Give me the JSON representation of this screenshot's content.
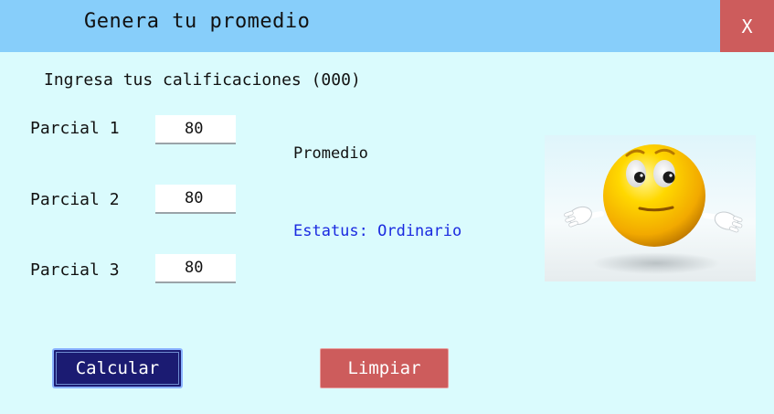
{
  "window": {
    "title": "Genera tu promedio",
    "close_label": "X"
  },
  "form": {
    "instructions": "Ingresa tus calificaciones (000)",
    "fields": [
      {
        "label": "Parcial 1",
        "value": "80"
      },
      {
        "label": "Parcial 2",
        "value": "80"
      },
      {
        "label": "Parcial 3",
        "value": "80"
      }
    ]
  },
  "results": {
    "average_label": "Promedio",
    "status_text": "Estatus: Ordinario"
  },
  "actions": {
    "calculate_label": "Calcular",
    "clear_label": "Limpiar"
  },
  "image": {
    "icon": "emoji-shrug-icon"
  },
  "colors": {
    "background": "#dafbfd",
    "titlebar": "#87cefa",
    "close_button": "#cd5c5c",
    "calculate_button": "#1b1b72",
    "clear_button": "#cd5c5c",
    "status_text": "#1a2ae0"
  }
}
